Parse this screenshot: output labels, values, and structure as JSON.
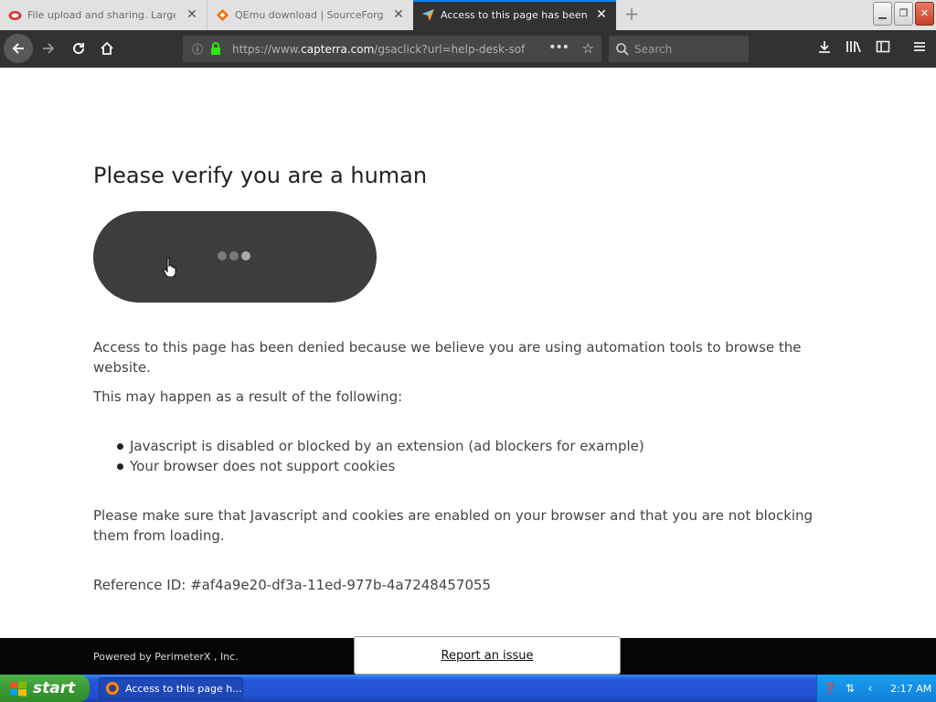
{
  "browser": {
    "tabs": [
      {
        "title": "File upload and sharing. Large fil",
        "active": false,
        "favicon": "red-cloud-icon"
      },
      {
        "title": "QEmu download | SourceForge.n",
        "active": false,
        "favicon": "sourceforge-diamond-icon"
      },
      {
        "title": "Access to this page has been deni",
        "active": true,
        "favicon": "capterra-arrow-icon"
      }
    ],
    "new_tab": "+",
    "url": {
      "prefix": "https://www.",
      "domain": "capterra.com",
      "path": "/gsaclick?url=help-desk-soft"
    },
    "search_placeholder": "Search",
    "window_controls": [
      "minimize",
      "restore",
      "close"
    ]
  },
  "page": {
    "headline": "Please verify you are a human",
    "denied_text": "Access to this page has been denied because we believe you are using automation tools to browse the website.",
    "reasons_intro": "This may happen as a result of the following:",
    "reasons": [
      "Javascript is disabled or blocked by an extension (ad blockers for example)",
      "Your browser does not support cookies"
    ],
    "instructions": "Please make sure that Javascript and cookies are enabled on your browser and that you are not blocking them from loading.",
    "reference": "Reference ID: #af4a9e20-df3a-11ed-977b-4a7248457055"
  },
  "footer": {
    "powered_by": "Powered by PerimeterX , Inc.",
    "report_label": "Report an issue"
  },
  "taskbar": {
    "start_label": "start",
    "task_item": "Access to this page h...",
    "clock": "2:17 AM"
  },
  "colors": {
    "toolbar": "#323234",
    "captcha_pill": "#3d3d3d",
    "accent": "#0a84ff"
  }
}
